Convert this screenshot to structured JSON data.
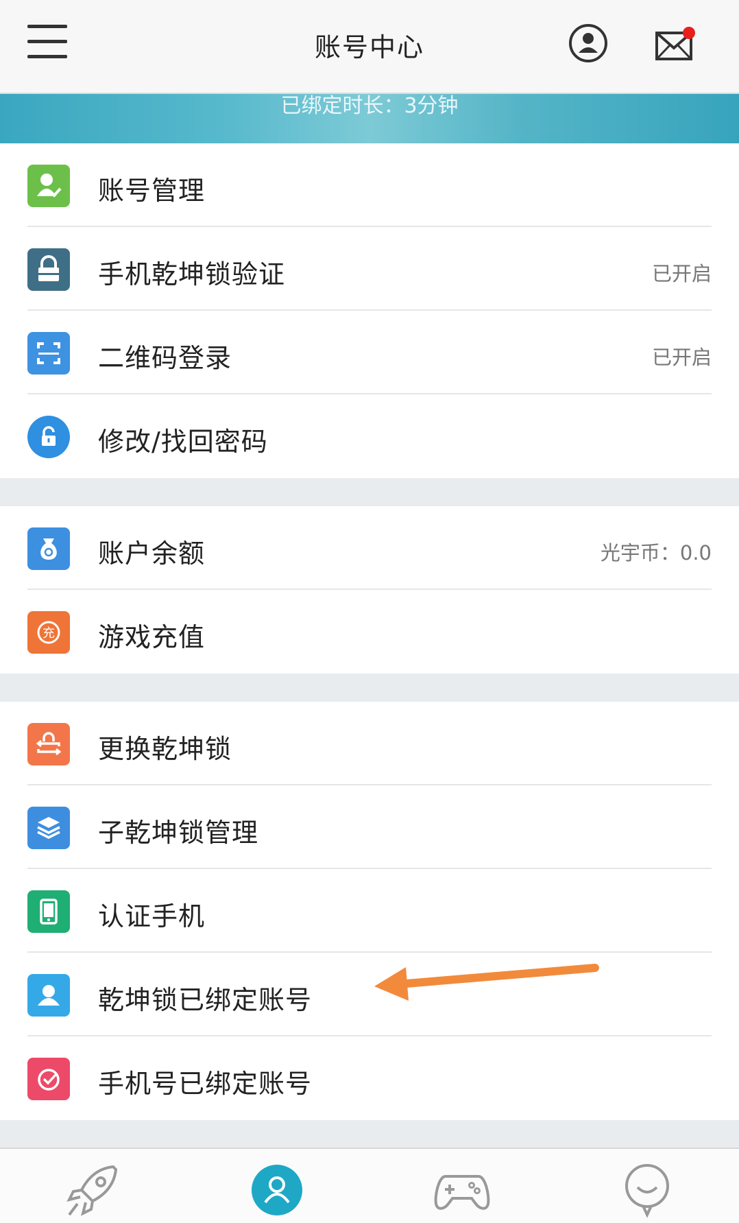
{
  "header": {
    "title": "账号中心"
  },
  "banner": {
    "text": "已绑定时长：3分钟"
  },
  "groups": [
    {
      "items": [
        {
          "label": "账号管理",
          "value": "",
          "icon": "account-manage-icon",
          "color": "#6cc04a"
        },
        {
          "label": "手机乾坤锁验证",
          "value": "已开启",
          "icon": "lock-icon",
          "color": "#3f6f86"
        },
        {
          "label": "二维码登录",
          "value": "已开启",
          "icon": "qr-scan-icon",
          "color": "#3e92e2"
        },
        {
          "label": "修改/找回密码",
          "value": "",
          "icon": "padlock-round-icon",
          "color": "#2f8fe0"
        }
      ]
    },
    {
      "items": [
        {
          "label": "账户余额",
          "value": "光宇币：0.0",
          "icon": "money-bag-icon",
          "color": "#3d8fe0"
        },
        {
          "label": "游戏充值",
          "value": "",
          "icon": "recharge-icon",
          "color": "#ef7437"
        }
      ]
    },
    {
      "items": [
        {
          "label": "更换乾坤锁",
          "value": "",
          "icon": "swap-lock-icon",
          "color": "#f3764a"
        },
        {
          "label": "子乾坤锁管理",
          "value": "",
          "icon": "layers-icon",
          "color": "#3e8ee0"
        },
        {
          "label": "认证手机",
          "value": "",
          "icon": "phone-icon",
          "color": "#1fae74"
        },
        {
          "label": "乾坤锁已绑定账号",
          "value": "",
          "icon": "user-silhouette-icon",
          "color": "#35a9e8"
        },
        {
          "label": "手机号已绑定账号",
          "value": "",
          "icon": "check-circle-icon",
          "color": "#ec4a68"
        }
      ]
    }
  ],
  "tabs": [
    {
      "icon": "rocket-icon"
    },
    {
      "icon": "user-icon",
      "active": true,
      "color": "#1ea8c6"
    },
    {
      "icon": "gamepad-icon"
    },
    {
      "icon": "chat-bubble-icon"
    }
  ],
  "annotation": {
    "color": "#f28a3b"
  }
}
